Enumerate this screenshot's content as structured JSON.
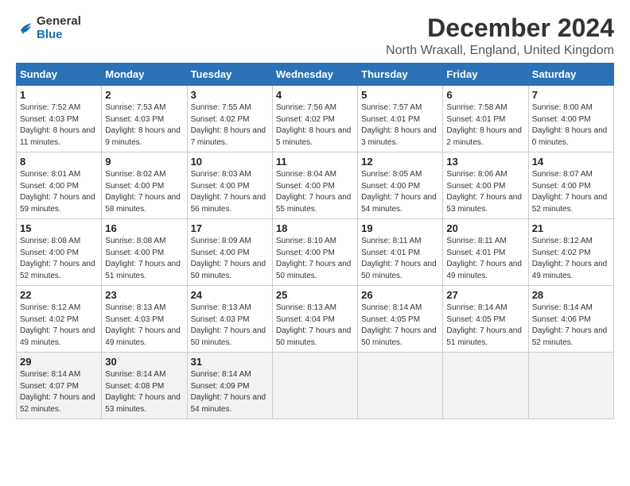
{
  "logo": {
    "general": "General",
    "blue": "Blue"
  },
  "header": {
    "month": "December 2024",
    "location": "North Wraxall, England, United Kingdom"
  },
  "weekdays": [
    "Sunday",
    "Monday",
    "Tuesday",
    "Wednesday",
    "Thursday",
    "Friday",
    "Saturday"
  ],
  "weeks": [
    [
      {
        "day": "1",
        "sunrise": "Sunrise: 7:52 AM",
        "sunset": "Sunset: 4:03 PM",
        "daylight": "Daylight: 8 hours and 11 minutes."
      },
      {
        "day": "2",
        "sunrise": "Sunrise: 7:53 AM",
        "sunset": "Sunset: 4:03 PM",
        "daylight": "Daylight: 8 hours and 9 minutes."
      },
      {
        "day": "3",
        "sunrise": "Sunrise: 7:55 AM",
        "sunset": "Sunset: 4:02 PM",
        "daylight": "Daylight: 8 hours and 7 minutes."
      },
      {
        "day": "4",
        "sunrise": "Sunrise: 7:56 AM",
        "sunset": "Sunset: 4:02 PM",
        "daylight": "Daylight: 8 hours and 5 minutes."
      },
      {
        "day": "5",
        "sunrise": "Sunrise: 7:57 AM",
        "sunset": "Sunset: 4:01 PM",
        "daylight": "Daylight: 8 hours and 3 minutes."
      },
      {
        "day": "6",
        "sunrise": "Sunrise: 7:58 AM",
        "sunset": "Sunset: 4:01 PM",
        "daylight": "Daylight: 8 hours and 2 minutes."
      },
      {
        "day": "7",
        "sunrise": "Sunrise: 8:00 AM",
        "sunset": "Sunset: 4:00 PM",
        "daylight": "Daylight: 8 hours and 0 minutes."
      }
    ],
    [
      {
        "day": "8",
        "sunrise": "Sunrise: 8:01 AM",
        "sunset": "Sunset: 4:00 PM",
        "daylight": "Daylight: 7 hours and 59 minutes."
      },
      {
        "day": "9",
        "sunrise": "Sunrise: 8:02 AM",
        "sunset": "Sunset: 4:00 PM",
        "daylight": "Daylight: 7 hours and 58 minutes."
      },
      {
        "day": "10",
        "sunrise": "Sunrise: 8:03 AM",
        "sunset": "Sunset: 4:00 PM",
        "daylight": "Daylight: 7 hours and 56 minutes."
      },
      {
        "day": "11",
        "sunrise": "Sunrise: 8:04 AM",
        "sunset": "Sunset: 4:00 PM",
        "daylight": "Daylight: 7 hours and 55 minutes."
      },
      {
        "day": "12",
        "sunrise": "Sunrise: 8:05 AM",
        "sunset": "Sunset: 4:00 PM",
        "daylight": "Daylight: 7 hours and 54 minutes."
      },
      {
        "day": "13",
        "sunrise": "Sunrise: 8:06 AM",
        "sunset": "Sunset: 4:00 PM",
        "daylight": "Daylight: 7 hours and 53 minutes."
      },
      {
        "day": "14",
        "sunrise": "Sunrise: 8:07 AM",
        "sunset": "Sunset: 4:00 PM",
        "daylight": "Daylight: 7 hours and 52 minutes."
      }
    ],
    [
      {
        "day": "15",
        "sunrise": "Sunrise: 8:08 AM",
        "sunset": "Sunset: 4:00 PM",
        "daylight": "Daylight: 7 hours and 52 minutes."
      },
      {
        "day": "16",
        "sunrise": "Sunrise: 8:08 AM",
        "sunset": "Sunset: 4:00 PM",
        "daylight": "Daylight: 7 hours and 51 minutes."
      },
      {
        "day": "17",
        "sunrise": "Sunrise: 8:09 AM",
        "sunset": "Sunset: 4:00 PM",
        "daylight": "Daylight: 7 hours and 50 minutes."
      },
      {
        "day": "18",
        "sunrise": "Sunrise: 8:10 AM",
        "sunset": "Sunset: 4:00 PM",
        "daylight": "Daylight: 7 hours and 50 minutes."
      },
      {
        "day": "19",
        "sunrise": "Sunrise: 8:11 AM",
        "sunset": "Sunset: 4:01 PM",
        "daylight": "Daylight: 7 hours and 50 minutes."
      },
      {
        "day": "20",
        "sunrise": "Sunrise: 8:11 AM",
        "sunset": "Sunset: 4:01 PM",
        "daylight": "Daylight: 7 hours and 49 minutes."
      },
      {
        "day": "21",
        "sunrise": "Sunrise: 8:12 AM",
        "sunset": "Sunset: 4:02 PM",
        "daylight": "Daylight: 7 hours and 49 minutes."
      }
    ],
    [
      {
        "day": "22",
        "sunrise": "Sunrise: 8:12 AM",
        "sunset": "Sunset: 4:02 PM",
        "daylight": "Daylight: 7 hours and 49 minutes."
      },
      {
        "day": "23",
        "sunrise": "Sunrise: 8:13 AM",
        "sunset": "Sunset: 4:03 PM",
        "daylight": "Daylight: 7 hours and 49 minutes."
      },
      {
        "day": "24",
        "sunrise": "Sunrise: 8:13 AM",
        "sunset": "Sunset: 4:03 PM",
        "daylight": "Daylight: 7 hours and 50 minutes."
      },
      {
        "day": "25",
        "sunrise": "Sunrise: 8:13 AM",
        "sunset": "Sunset: 4:04 PM",
        "daylight": "Daylight: 7 hours and 50 minutes."
      },
      {
        "day": "26",
        "sunrise": "Sunrise: 8:14 AM",
        "sunset": "Sunset: 4:05 PM",
        "daylight": "Daylight: 7 hours and 50 minutes."
      },
      {
        "day": "27",
        "sunrise": "Sunrise: 8:14 AM",
        "sunset": "Sunset: 4:05 PM",
        "daylight": "Daylight: 7 hours and 51 minutes."
      },
      {
        "day": "28",
        "sunrise": "Sunrise: 8:14 AM",
        "sunset": "Sunset: 4:06 PM",
        "daylight": "Daylight: 7 hours and 52 minutes."
      }
    ],
    [
      {
        "day": "29",
        "sunrise": "Sunrise: 8:14 AM",
        "sunset": "Sunset: 4:07 PM",
        "daylight": "Daylight: 7 hours and 52 minutes."
      },
      {
        "day": "30",
        "sunrise": "Sunrise: 8:14 AM",
        "sunset": "Sunset: 4:08 PM",
        "daylight": "Daylight: 7 hours and 53 minutes."
      },
      {
        "day": "31",
        "sunrise": "Sunrise: 8:14 AM",
        "sunset": "Sunset: 4:09 PM",
        "daylight": "Daylight: 7 hours and 54 minutes."
      },
      null,
      null,
      null,
      null
    ]
  ]
}
